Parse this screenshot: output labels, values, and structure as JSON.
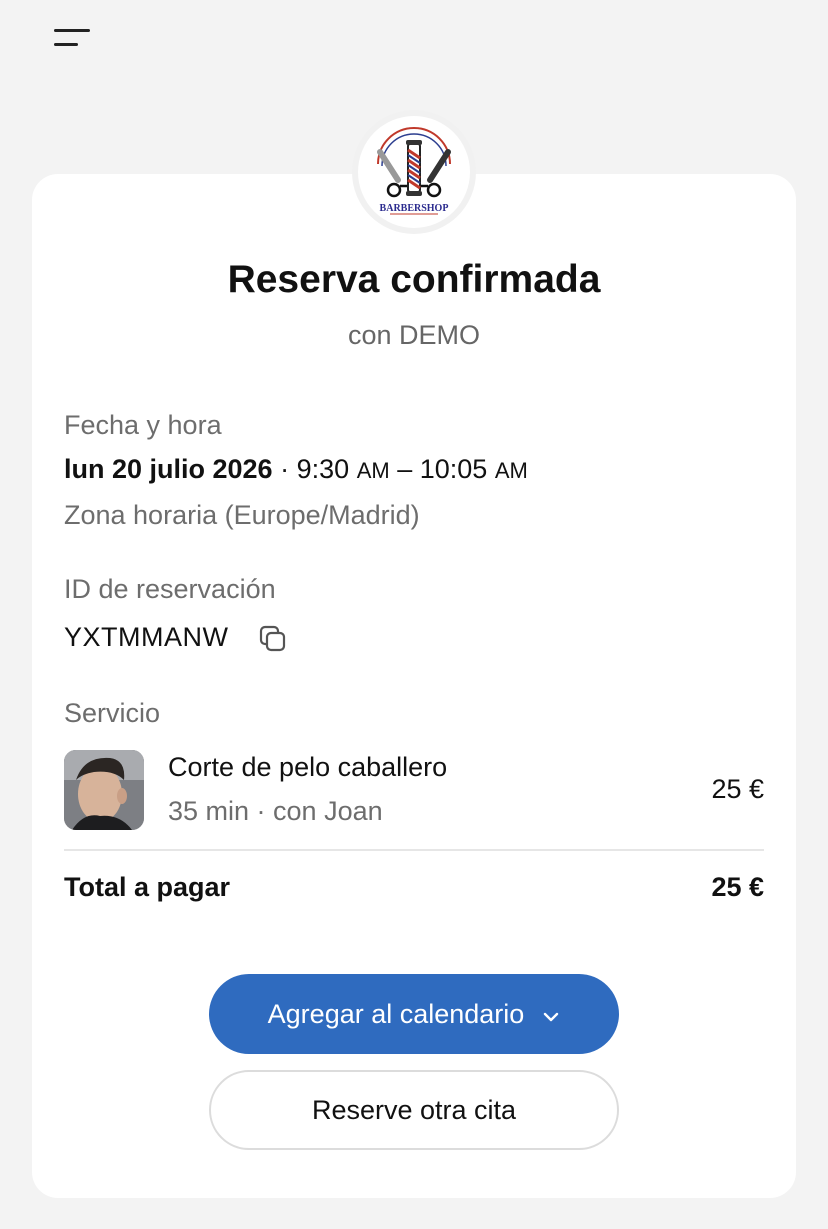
{
  "nav": {
    "menu_icon": "hamburger-menu-icon"
  },
  "brand": {
    "logo_text": "BARBERSHOP",
    "logo_icon": "barber-pole-logo"
  },
  "header": {
    "title": "Reserva confirmada",
    "subtitle": "con DEMO"
  },
  "datetime": {
    "label": "Fecha y hora",
    "date": "lun 20 julio 2026",
    "separator": "·",
    "start_time": "9:30",
    "start_ampm": "AM",
    "dash": "–",
    "end_time": "10:05",
    "end_ampm": "AM",
    "timezone": "Zona horaria (Europe/Madrid)"
  },
  "booking": {
    "label": "ID de reservación",
    "id": "YXTMMANW",
    "copy_icon": "copy-icon"
  },
  "service": {
    "label": "Servicio",
    "name": "Corte de pelo caballero",
    "meta": "35 min · con Joan",
    "price": "25 €"
  },
  "total": {
    "label": "Total a pagar",
    "value": "25 €"
  },
  "actions": {
    "add_calendar": "Agregar al calendario",
    "add_calendar_icon": "chevron-down-icon",
    "book_another": "Reserve otra cita"
  },
  "colors": {
    "accent": "#2f6bbf",
    "background": "#f3f3f3",
    "card": "#ffffff"
  }
}
